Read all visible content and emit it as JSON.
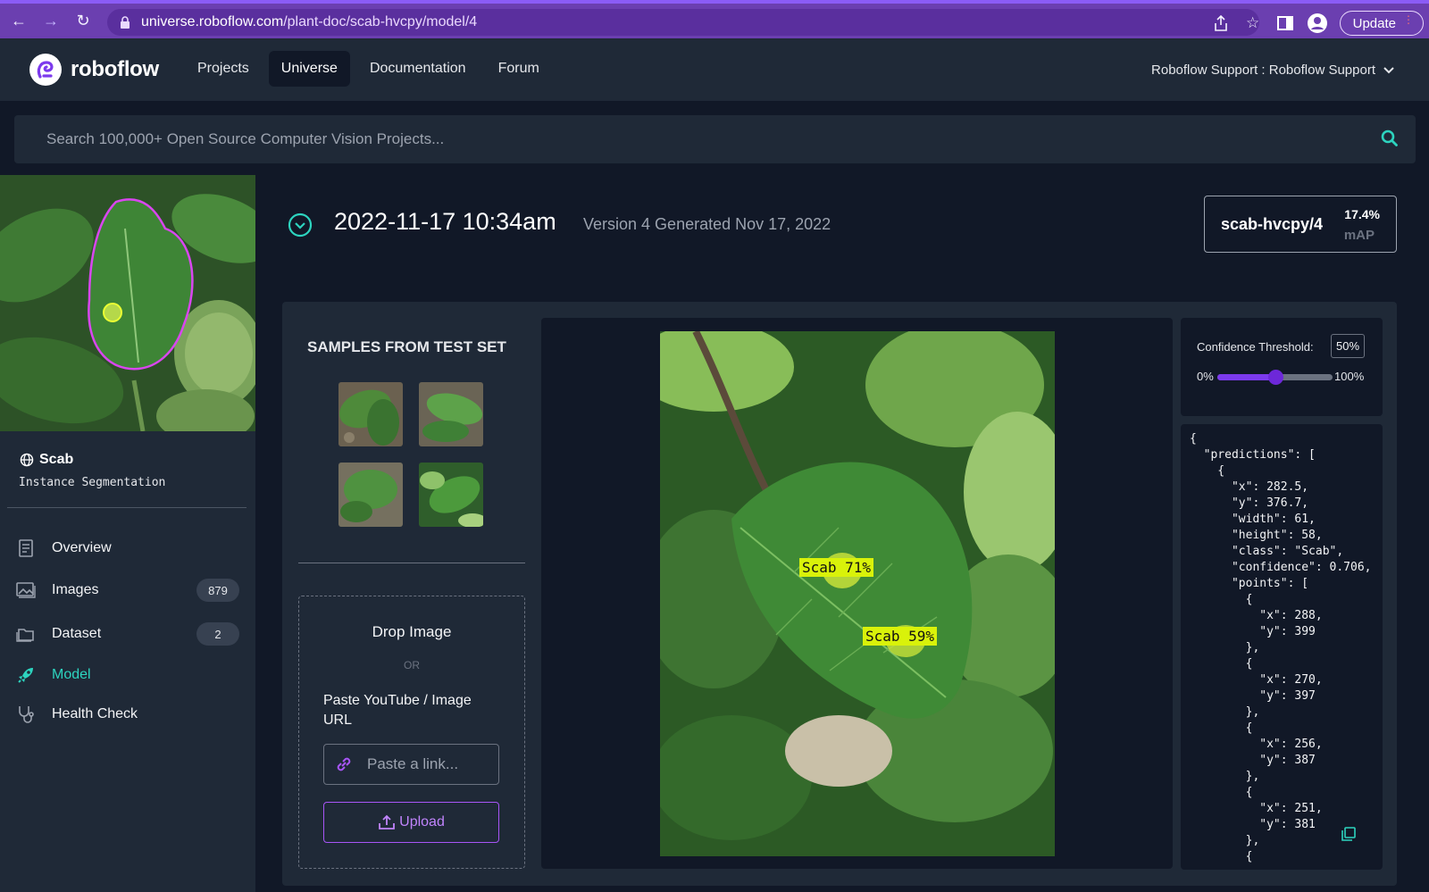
{
  "browser": {
    "url_host": "universe.roboflow.com",
    "url_path": "/plant-doc/scab-hvcpy/model/4",
    "update_label": "Update"
  },
  "header": {
    "logo_text": "roboflow",
    "nav": [
      {
        "label": "Projects",
        "active": false
      },
      {
        "label": "Universe",
        "active": true
      },
      {
        "label": "Documentation",
        "active": false
      },
      {
        "label": "Forum",
        "active": false
      }
    ],
    "workspace": "Roboflow Support : Roboflow Support"
  },
  "search": {
    "placeholder": "Search 100,000+ Open Source Computer Vision Projects..."
  },
  "sidebar": {
    "project_name": "Scab",
    "project_type": "Instance Segmentation",
    "items": [
      {
        "label": "Overview",
        "icon": "document-icon"
      },
      {
        "label": "Images",
        "icon": "images-icon",
        "count": "879"
      },
      {
        "label": "Dataset",
        "icon": "folder-icon",
        "count": "2"
      },
      {
        "label": "Model",
        "icon": "rocket-icon",
        "active": true
      },
      {
        "label": "Health Check",
        "icon": "stethoscope-icon"
      }
    ]
  },
  "version": {
    "date": "2022-11-17 10:34am",
    "subtitle": "Version 4 Generated Nov 17, 2022",
    "model_id": "scab-hvcpy/4",
    "map_value": "17.4%",
    "map_label": "mAP"
  },
  "samples": {
    "title": "SAMPLES FROM TEST SET"
  },
  "drop": {
    "title": "Drop Image",
    "or": "OR",
    "paste_label": "Paste YouTube / Image URL",
    "link_placeholder": "Paste a link...",
    "upload_label": "Upload"
  },
  "predictions_overlay": [
    {
      "label": "Scab 71%"
    },
    {
      "label": "Scab 59%"
    }
  ],
  "confidence": {
    "title": "Confidence Threshold:",
    "value": "50%",
    "min_label": "0%",
    "max_label": "100%",
    "fraction": 0.5
  },
  "json_output": "{\n  \"predictions\": [\n    {\n      \"x\": 282.5,\n      \"y\": 376.7,\n      \"width\": 61,\n      \"height\": 58,\n      \"class\": \"Scab\",\n      \"confidence\": 0.706,\n      \"points\": [\n        {\n          \"x\": 288,\n          \"y\": 399\n        },\n        {\n          \"x\": 270,\n          \"y\": 397\n        },\n        {\n          \"x\": 256,\n          \"y\": 387\n        },\n        {\n          \"x\": 251,\n          \"y\": 381\n        },\n        {",
  "colors": {
    "accent_teal": "#2dd4bf",
    "accent_purple": "#a855f7",
    "label_yellow": "#d9f20a"
  }
}
